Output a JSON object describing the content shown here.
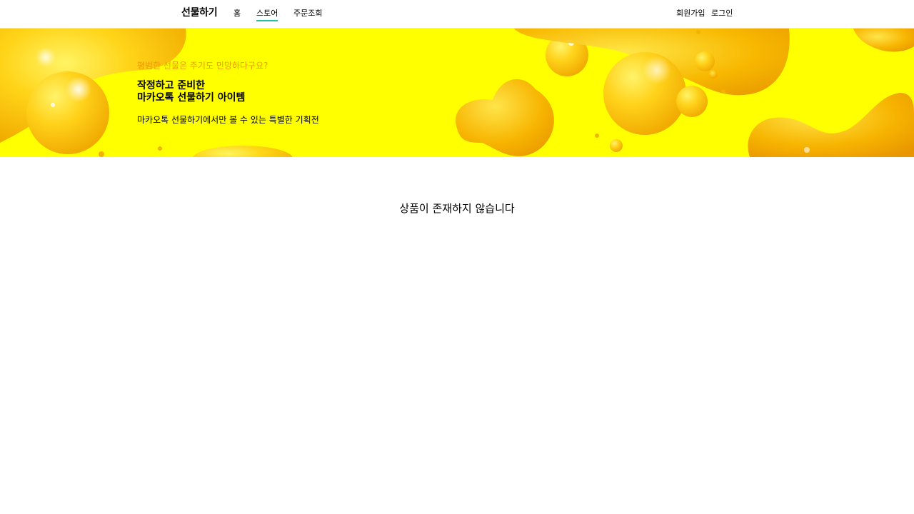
{
  "header": {
    "logo": "선물하기",
    "nav": [
      {
        "label": "홈"
      },
      {
        "label": "스토어"
      },
      {
        "label": "주문조회"
      }
    ],
    "util": {
      "signup": "회원가입",
      "login": "로그인"
    },
    "active_tab": "스토어",
    "accent_color": "#23c1a8"
  },
  "banner": {
    "eyebrow": "평범한 선물은 주기도 민망하다구요?",
    "title_line1": "작정하고 준비한",
    "title_line2": "마카오톡 선물하기 아이템",
    "description": "마카오톡 선물하기에서만 볼 수 있는 특별한 기획전",
    "background_color": "#ffff00",
    "eyebrow_color": "#f09a00"
  },
  "main": {
    "empty_message": "상품이 존재하지 않습니다"
  }
}
